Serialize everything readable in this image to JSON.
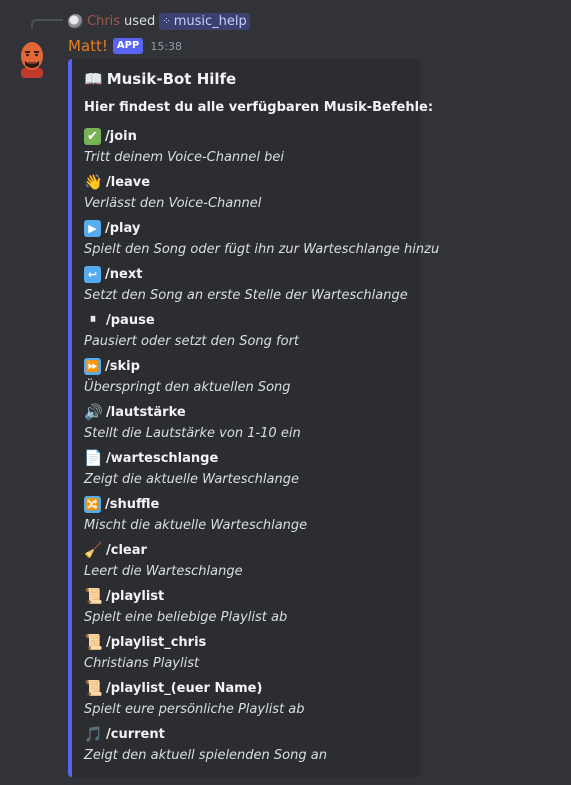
{
  "reply": {
    "user": "Chris",
    "used_text": "used",
    "command_icon": "slash-command-icon",
    "command": "music_help"
  },
  "author": {
    "name": "Matt!",
    "badge": "APP",
    "timestamp": "15:38",
    "name_color": "#e67e22"
  },
  "embed": {
    "accent_color": "#5865f2",
    "title_icon": "📖",
    "title": "Musik-Bot Hilfe",
    "description": "Hier findest du alle verfügbaren Musik-Befehle:",
    "fields": [
      {
        "icon": "✔",
        "icon_name": "check-mark-icon",
        "name": "/join",
        "value": "Tritt deinem Voice-Channel bei"
      },
      {
        "icon": "👋",
        "icon_name": "waving-hand-icon",
        "name": "/leave",
        "value": "Verlässt den Voice-Channel"
      },
      {
        "icon": "▶",
        "icon_name": "play-icon",
        "name": "/play",
        "value": "Spielt den Song oder fügt ihn zur Warteschlange hinzu"
      },
      {
        "icon": "↩",
        "icon_name": "return-arrow-icon",
        "name": "/next",
        "value": "Setzt den Song an erste Stelle der Warteschlange"
      },
      {
        "icon": "⏸",
        "icon_name": "pause-icon",
        "name": "/pause",
        "value": "Pausiert oder setzt den Song fort"
      },
      {
        "icon": "⏩",
        "icon_name": "fast-forward-icon",
        "name": "/skip",
        "value": "Überspringt den aktuellen Song"
      },
      {
        "icon": "🔊",
        "icon_name": "speaker-icon",
        "name": "/lautstärke",
        "value": "Stellt die Lautstärke von 1-10 ein"
      },
      {
        "icon": "📄",
        "icon_name": "document-icon",
        "name": "/warteschlange",
        "value": "Zeigt die aktuelle Warteschlange"
      },
      {
        "icon": "🔀",
        "icon_name": "shuffle-icon",
        "name": "/shuffle",
        "value": "Mischt die aktuelle Warteschlange"
      },
      {
        "icon": "🧹",
        "icon_name": "broom-icon",
        "name": "/clear",
        "value": "Leert die Warteschlange"
      },
      {
        "icon": "📜",
        "icon_name": "scroll-icon",
        "name": "/playlist",
        "value": "Spielt eine beliebige Playlist ab"
      },
      {
        "icon": "📜",
        "icon_name": "scroll-icon",
        "name": "/playlist_chris",
        "value": "Christians Playlist"
      },
      {
        "icon": "📜",
        "icon_name": "scroll-icon",
        "name": "/playlist_(euer Name)",
        "value": "Spielt eure persönliche Playlist ab"
      },
      {
        "icon": "🎵",
        "icon_name": "musical-note-icon",
        "name": "/current",
        "value": "Zeigt den aktuell spielenden Song an"
      }
    ]
  }
}
